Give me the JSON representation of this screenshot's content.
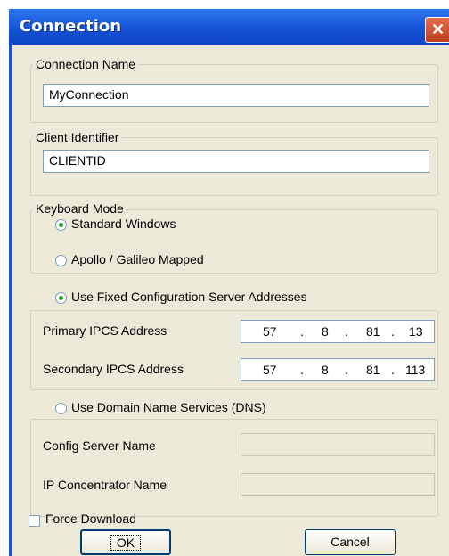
{
  "window": {
    "title": "Connection",
    "close_glyph": "✕"
  },
  "connection_name": {
    "legend": "Connection Name",
    "value": "MyConnection"
  },
  "client_identifier": {
    "legend": "Client Identifier",
    "value": "CLIENTID"
  },
  "keyboard_mode": {
    "legend": "Keyboard Mode",
    "options": [
      {
        "label": "Standard Windows",
        "checked": true
      },
      {
        "label": "Apollo / Galileo Mapped",
        "checked": false
      }
    ]
  },
  "fixed_addresses": {
    "radio_label": "Use Fixed Configuration Server Addresses",
    "checked": true,
    "primary": {
      "label": "Primary IPCS Address",
      "octets": [
        "57",
        "8",
        "81",
        "13"
      ]
    },
    "secondary": {
      "label": "Secondary IPCS Address",
      "octets": [
        "57",
        "8",
        "81",
        "113"
      ]
    },
    "separator": "."
  },
  "dns": {
    "radio_label": "Use Domain Name Services (DNS)",
    "checked": false,
    "config_server_label": "Config Server Name",
    "config_server_value": "",
    "ip_concentrator_label": "IP Concentrator  Name",
    "ip_concentrator_value": ""
  },
  "force_download": {
    "label": "Force Download",
    "checked": false
  },
  "buttons": {
    "ok": "OK",
    "cancel": "Cancel"
  }
}
